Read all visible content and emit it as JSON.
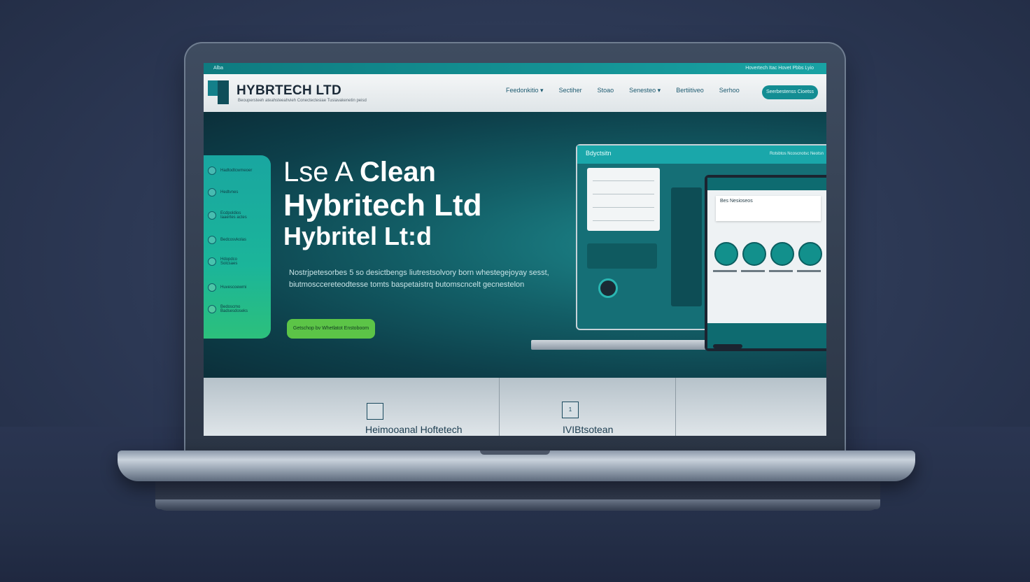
{
  "site": {
    "topbar": {
      "left": "Alba",
      "right": "Hovertech Itac  Hovet  Pbbs  Lyio"
    },
    "logo": {
      "name": "HYBRTECH LTD",
      "tagline": "Beoupersteeh ateahsteeahvieh Conectectesiae Tusiavakenetin peisd"
    },
    "nav": [
      {
        "label": "Feedonkitio ▾"
      },
      {
        "label": "Sectiher"
      },
      {
        "label": "Stoao"
      },
      {
        "label": "Senesteo ▾"
      },
      {
        "label": "Bertiitiveo"
      },
      {
        "label": "Serhoo"
      }
    ],
    "top_cta": "Seerbestenss Cioetss"
  },
  "sidebar": {
    "items": [
      {
        "label": "Hadtodtcwmeoer"
      },
      {
        "label": "Hedtvnes"
      },
      {
        "label": "Ecdpoldios Iaaertes actes"
      },
      {
        "label": "Bedcosvkolas"
      },
      {
        "label": "Hdopdco Solcsaes"
      },
      {
        "label": "Huvescoewmi"
      },
      {
        "label": "Bedoscmo Badsesdoseks"
      }
    ]
  },
  "hero": {
    "headline_line1_pre": "Lse A",
    "headline_line1_bold": "Clean",
    "headline_line2": "Hybritech Ltd",
    "headline_line3": "Hybritel Lt:d",
    "description": "Nostrjpetesorbes 5 so desictbengs liutrestsolvory born whestegejoyay sesst, biutmosccereteodtesse tomts baspetaistrq butomscncelt gecnestelon",
    "button": "Getschop bv Whetlatot Enstoboom"
  },
  "devices": {
    "laptop_title": "Bdyctsitn",
    "tablet_header": "Bes Nesioseos",
    "laptop_topright": "Rotsbtos    Ncoscnotsc Neotsn"
  },
  "features": {
    "items": [
      {
        "label": "Heimooanal Hoftetech",
        "icon": "image-icon"
      },
      {
        "label": "IVIBtsotean",
        "icon": "document-icon",
        "icon_text": "1"
      }
    ]
  }
}
